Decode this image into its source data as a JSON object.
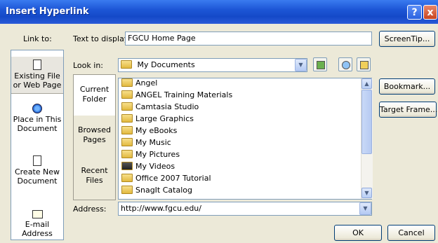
{
  "window": {
    "title": "Insert Hyperlink",
    "help_label": "?",
    "close_label": "x"
  },
  "link_to": {
    "label": "Link to:",
    "items": [
      {
        "label": "Existing File or Web Page",
        "icon": "existing-file-icon"
      },
      {
        "label": "Place in This Document",
        "icon": "place-document-icon"
      },
      {
        "label": "Create New Document",
        "icon": "new-document-icon"
      },
      {
        "label": "E-mail Address",
        "icon": "email-icon"
      }
    ]
  },
  "text_to_display": {
    "label": "Text to display:",
    "value": "FGCU Home Page"
  },
  "look_in": {
    "label": "Look in:",
    "value": "My Documents"
  },
  "sub_panel": {
    "items": [
      "Current Folder",
      "Browsed Pages",
      "Recent Files"
    ]
  },
  "files": [
    "Angel",
    "ANGEL Training Materials",
    "Camtasia Studio",
    "Large Graphics",
    "My eBooks",
    "My Music",
    "My Pictures",
    "My Videos",
    "Office 2007 Tutorial",
    "SnagIt Catalog"
  ],
  "address": {
    "label": "Address:",
    "value": "http://www.fgcu.edu/"
  },
  "buttons": {
    "screentip": "ScreenTip...",
    "bookmark": "Bookmark...",
    "target_frame": "Target Frame...",
    "ok": "OK",
    "cancel": "Cancel"
  }
}
